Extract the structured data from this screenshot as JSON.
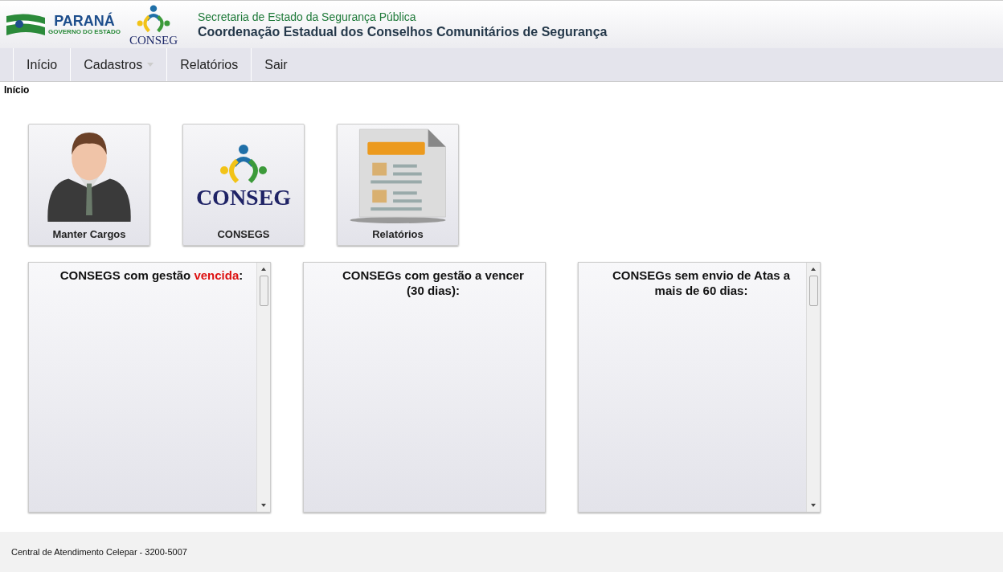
{
  "header": {
    "state_logo": {
      "name": "PARANÁ",
      "subtitle": "GOVERNO DO ESTADO"
    },
    "conseg_logo": {
      "text": "CONSEG"
    },
    "secretariat": "Secretaria de Estado da Segurança Pública",
    "title": "Coordenação Estadual dos Conselhos Comunitários de Segurança"
  },
  "menu": [
    {
      "label": "Início",
      "has_dropdown": false
    },
    {
      "label": "Cadastros",
      "has_dropdown": true
    },
    {
      "label": "Relatórios",
      "has_dropdown": false
    },
    {
      "label": "Sair",
      "has_dropdown": false
    }
  ],
  "breadcrumb": "Início",
  "tiles": [
    {
      "kind": "person",
      "label": "Manter Cargos"
    },
    {
      "kind": "logo",
      "label": "CONSEGS",
      "logo_text": "CONSEG"
    },
    {
      "kind": "report",
      "label": "Relatórios"
    }
  ],
  "panels": [
    {
      "title": "CONSEGS com gestão",
      "alert": "vencida",
      "suffix": ":",
      "scrollbar": true
    },
    {
      "title": "CONSEGs com gestão a vencer (30 dias):",
      "scrollbar": false
    },
    {
      "title": "CONSEGs sem envio de Atas a mais de 60 dias:",
      "scrollbar": true
    }
  ],
  "footer": "Central de Atendimento Celepar - 3200-5007"
}
